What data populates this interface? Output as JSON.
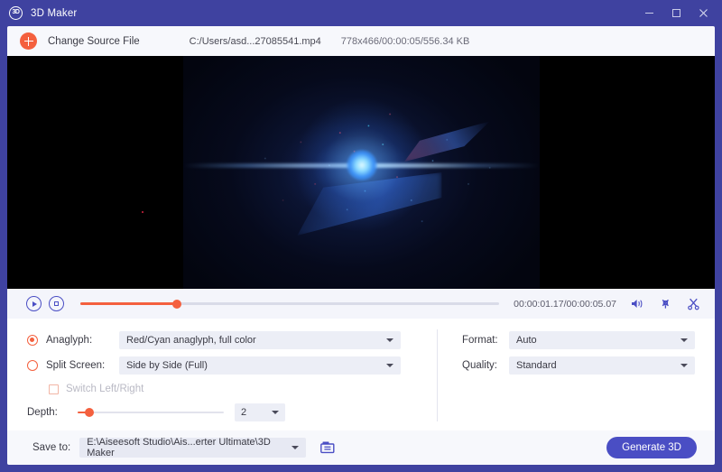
{
  "window": {
    "title": "3D Maker",
    "app_icon": "3d-circle-icon",
    "minimize_label": "–",
    "maximize_label": "□",
    "close_label": "✕"
  },
  "source_bar": {
    "add_icon": "plus-circle-icon",
    "change_source_label": "Change Source File",
    "file_path": "C:/Users/asd...27085541.mp4",
    "file_meta": "778x466/00:00:05/556.34 KB"
  },
  "preview": {
    "description": "Video preview: dark space scene with bright blue light burst and red/cyan anaglyph particles, pillarboxed with black bars"
  },
  "playback": {
    "play_icon": "play-circle-icon",
    "stop_icon": "stop-circle-icon",
    "progress_percent": 23,
    "time_display": "00:00:01.17/00:00:05.07",
    "volume_icon": "speaker-icon",
    "snapshot_icon": "snapshot-icon",
    "cut_icon": "scissors-icon"
  },
  "settings": {
    "anaglyph": {
      "label": "Anaglyph:",
      "selected": true,
      "value": "Red/Cyan anaglyph, full color"
    },
    "split_screen": {
      "label": "Split Screen:",
      "selected": false,
      "value": "Side by Side (Full)"
    },
    "switch_lr": {
      "label": "Switch Left/Right",
      "checked": false,
      "disabled": true
    },
    "depth": {
      "label": "Depth:",
      "value": "2",
      "slider_percent": 7
    },
    "format": {
      "label": "Format:",
      "value": "Auto"
    },
    "quality": {
      "label": "Quality:",
      "value": "Standard"
    }
  },
  "save_bar": {
    "save_to_label": "Save to:",
    "save_path": "E:\\Aiseesoft Studio\\Ais...erter Ultimate\\3D Maker",
    "folder_icon": "folder-icon",
    "generate_label": "Generate 3D"
  },
  "colors": {
    "accent_purple": "#4a4ec4",
    "accent_orange": "#f4603e",
    "titlebar": "#3f42a0",
    "panel_bg": "#ffffff"
  }
}
